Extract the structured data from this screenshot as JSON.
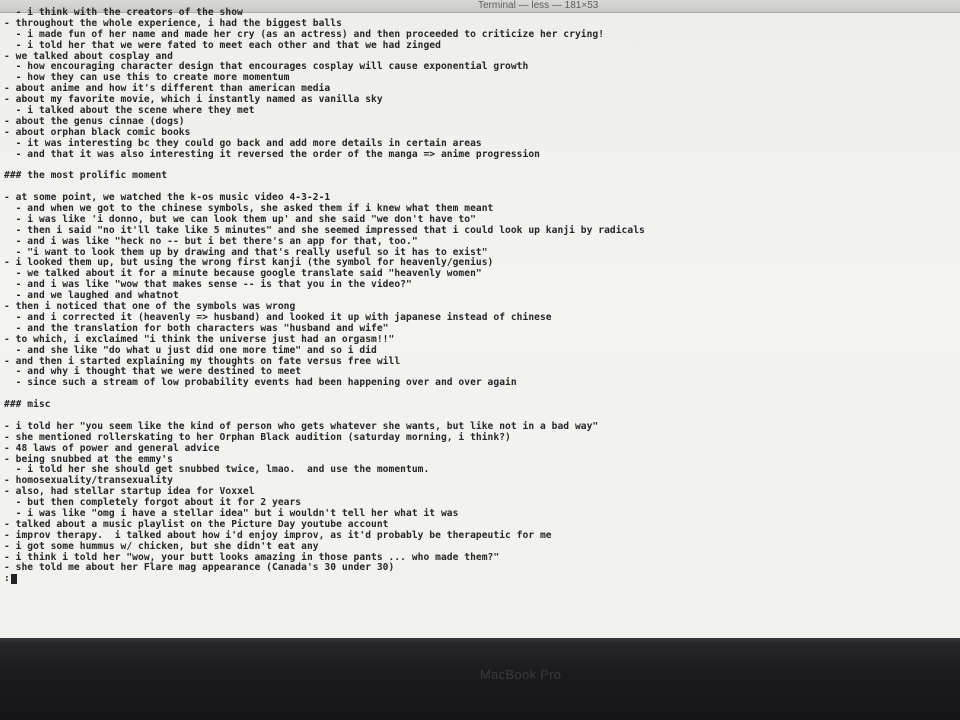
{
  "window": {
    "title": "Terminal — less — 181×53"
  },
  "terminal": {
    "lines": [
      "  - i think with the creators of the show",
      "- throughout the whole experience, i had the biggest balls",
      "  - i made fun of her name and made her cry (as an actress) and then proceeded to criticize her crying!",
      "  - i told her that we were fated to meet each other and that we had zinged",
      "- we talked about cosplay and",
      "  - how encouraging character design that encourages cosplay will cause exponential growth",
      "  - how they can use this to create more momentum",
      "- about anime and how it's different than american media",
      "- about my favorite movie, which i instantly named as vanilla sky",
      "  - i talked about the scene where they met",
      "- about the genus cinnae (dogs)",
      "- about orphan black comic books",
      "  - it was interesting bc they could go back and add more details in certain areas",
      "  - and that it was also interesting it reversed the order of the manga => anime progression",
      "",
      "### the most prolific moment",
      "",
      "- at some point, we watched the k-os music video 4-3-2-1",
      "  - and when we got to the chinese symbols, she asked them if i knew what them meant",
      "  - i was like 'i donno, but we can look them up' and she said \"we don't have to\"",
      "  - then i said \"no it'll take like 5 minutes\" and she seemed impressed that i could look up kanji by radicals",
      "  - and i was like \"heck no -- but i bet there's an app for that, too.\"",
      "  - \"i want to look them up by drawing and that's really useful so it has to exist\"",
      "- i looked them up, but using the wrong first kanji (the symbol for heavenly/genius)",
      "  - we talked about it for a minute because google translate said \"heavenly women\"",
      "  - and i was like \"wow that makes sense -- is that you in the video?\"",
      "  - and we laughed and whatnot",
      "- then i noticed that one of the symbols was wrong",
      "  - and i corrected it (heavenly => husband) and looked it up with japanese instead of chinese",
      "  - and the translation for both characters was \"husband and wife\"",
      "- to which, i exclaimed \"i think the universe just had an orgasm!!\"",
      "  - and she like \"do what u just did one more time\" and so i did",
      "- and then i started explaining my thoughts on fate versus free will",
      "  - and why i thought that we were destined to meet",
      "  - since such a stream of low probability events had been happening over and over again",
      "",
      "### misc",
      "",
      "- i told her \"you seem like the kind of person who gets whatever she wants, but like not in a bad way\"",
      "- she mentioned rollerskating to her Orphan Black audition (saturday morning, i think?)",
      "- 48 laws of power and general advice",
      "- being snubbed at the emmy's",
      "  - i told her she should get snubbed twice, lmao.  and use the momentum.",
      "- homosexuality/transexuality",
      "- also, had stellar startup idea for Voxxel",
      "  - but then completely forgot about it for 2 years",
      "  - i was like \"omg i have a stellar idea\" but i wouldn't tell her what it was",
      "- talked about a music playlist on the Picture Day youtube account",
      "- improv therapy.  i talked about how i'd enjoy improv, as it'd probably be therapeutic for me",
      "- i got some hummus w/ chicken, but she didn't eat any",
      "- i think i told her \"wow, your butt looks amazing in those pants ... who made them?\"",
      "- she told me about her Flare mag appearance (Canada's 30 under 30)"
    ],
    "prompt": ":"
  },
  "laptop": {
    "brand": "MacBook Pro"
  }
}
